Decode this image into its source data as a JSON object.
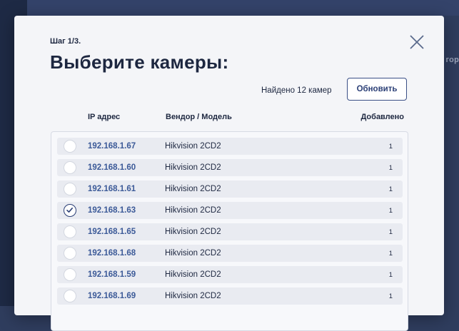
{
  "background": {
    "edge_text": "гор"
  },
  "modal": {
    "step": "Шаг 1/3.",
    "title": "Выберите камеры:",
    "found_text": "Найдено 12 камер",
    "refresh_label": "Обновить",
    "close_icon": "close-icon"
  },
  "columns": {
    "ip": "IP адрес",
    "vendor": "Вендор / Модель",
    "added": "Добавлено"
  },
  "cameras": [
    {
      "ip": "192.168.1.67",
      "vendor": "Hikvision 2CD2",
      "added": "1",
      "selected": false
    },
    {
      "ip": "192.168.1.60",
      "vendor": "Hikvision 2CD2",
      "added": "1",
      "selected": false
    },
    {
      "ip": "192.168.1.61",
      "vendor": "Hikvision 2CD2",
      "added": "1",
      "selected": false
    },
    {
      "ip": "192.168.1.63",
      "vendor": "Hikvision 2CD2",
      "added": "1",
      "selected": true
    },
    {
      "ip": "192.168.1.65",
      "vendor": "Hikvision 2CD2",
      "added": "1",
      "selected": false
    },
    {
      "ip": "192.168.1.68",
      "vendor": "Hikvision 2CD2",
      "added": "1",
      "selected": false
    },
    {
      "ip": "192.168.1.59",
      "vendor": "Hikvision 2CD2",
      "added": "1",
      "selected": false
    },
    {
      "ip": "192.168.1.69",
      "vendor": "Hikvision 2CD2",
      "added": "1",
      "selected": false
    }
  ],
  "colors": {
    "accent": "#2b3f76",
    "ip_link": "#3c5a98",
    "row_bg": "#e9ebf1",
    "modal_bg": "#f4f5f8",
    "backdrop": "#2f3d5e"
  }
}
